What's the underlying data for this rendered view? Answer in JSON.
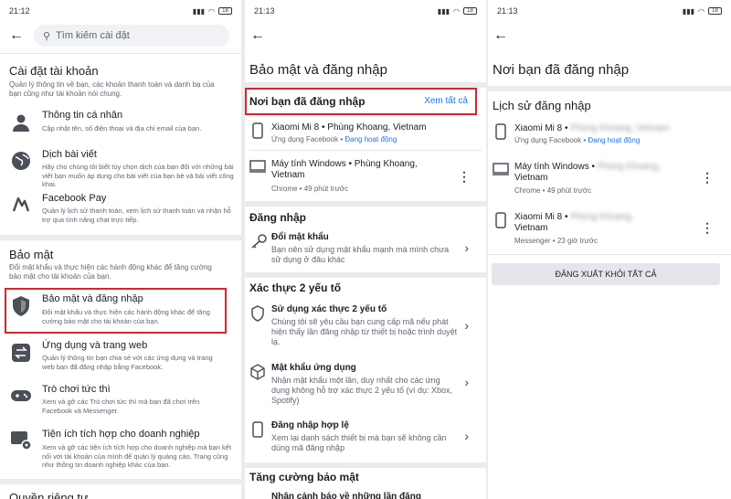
{
  "status": {
    "p1_time": "21:12",
    "p2_time": "21:13",
    "p3_time": "21:13",
    "battery": "18"
  },
  "p1": {
    "search_placeholder": "Tìm kiếm cài đặt",
    "account_title": "Cài đặt tài khoản",
    "account_desc": "Quản lý thông tin về bạn, các khoản thanh toán và danh bạ của bạn cũng như tài khoản nói chung.",
    "items1": [
      {
        "title": "Thông tin cá nhân",
        "desc": "Cập nhật tên, số điện thoại và địa chỉ email của bạn."
      },
      {
        "title": "Dịch bài viết",
        "desc": "Hãy cho chúng tôi biết tùy chọn dịch của bạn đối với những bài viết bạn muốn áp dụng cho bài viết của bạn bè và bài viết công khai."
      },
      {
        "title": "Facebook Pay",
        "desc": "Quản lý lịch sử thanh toán, xem lịch sử thanh toán và nhận hỗ trợ qua tính năng chat trực tiếp."
      }
    ],
    "security_title": "Bảo mật",
    "security_desc": "Đổi mật khẩu và thực hiện các hành động khác để tăng cường bảo mật cho tài khoản của bạn.",
    "items2": [
      {
        "title": "Bảo mật và đăng nhập",
        "desc": "Đổi mật khẩu và thực hiện các hành động khác để tăng cường bảo mật cho tài khoản của bạn."
      },
      {
        "title": "Ứng dụng và trang web",
        "desc": "Quản lý thông tin bạn chia sẻ với các ứng dụng và trang web bạn đã đăng nhập bằng Facebook."
      },
      {
        "title": "Trò chơi tức thì",
        "desc": "Xem và gỡ các Trò chơi tức thì mà bạn đã chơi trên Facebook và Messenger."
      },
      {
        "title": "Tiện ích tích hợp cho doanh nghiệp",
        "desc": "Xem và gỡ các tiện ích tích hợp cho doanh nghiệp mà bạn kết nối với tài khoản của mình để quản lý quảng cáo, Trang cũng như thông tin doanh nghiệp khác của bạn."
      }
    ],
    "partial": "Quyền riêng tư"
  },
  "p2": {
    "title": "Bảo mật và đăng nhập",
    "where_title": "Nơi bạn đã đăng nhập",
    "see_all": "Xem tất cả",
    "devices": [
      {
        "name": "Xiaomi Mi 8 • Phùng Khoang, Vietnam",
        "sub": "Ứng dụng Facebook • ",
        "active": "Đang hoạt động"
      },
      {
        "name": "Máy tính Windows • Phùng Khoang, Vietnam",
        "sub": "Chrome • 49 phút trước"
      }
    ],
    "login_title": "Đăng nhập",
    "change_pw": {
      "title": "Đổi mật khẩu",
      "desc": "Bạn nên sử dụng mật khẩu mạnh mà mình chưa sử dụng ở đâu khác"
    },
    "twofa_title": "Xác thực 2 yếu tố",
    "twofa": {
      "title": "Sử dụng xác thực 2 yếu tố",
      "desc": "Chúng tôi sẽ yêu cầu bạn cung cấp mã nếu phát hiện thấy lần đăng nhập từ thiết bị hoặc trình duyệt lạ."
    },
    "apppw": {
      "title": "Mật khẩu ứng dụng",
      "desc": "Nhận mật khẩu một lần, duy nhất cho các ứng dụng không hỗ trợ xác thực 2 yếu tố (ví dụ: Xbox, Spotify)"
    },
    "trusted": {
      "title": "Đăng nhập hợp lệ",
      "desc": "Xem lại danh sách thiết bị mà bạn sẽ không cần dùng mã đăng nhập"
    },
    "extra_title": "Tăng cường bảo mật",
    "partial": "Nhận cảnh báo về những lần đăng"
  },
  "p3": {
    "title": "Nơi bạn đã đăng nhập",
    "history_title": "Lịch sử đăng nhập",
    "devices": [
      {
        "name": "Xiaomi Mi 8 •",
        "loc": "Phùng Khoang, Vietnam",
        "sub": "Ứng dụng Facebook • ",
        "active": "Đang hoạt động"
      },
      {
        "name": "Máy tính Windows •",
        "loc": "Phùng Khoang,",
        "name2": "Vietnam",
        "sub": "Chrome • 49 phút trước"
      },
      {
        "name": "Xiaomi Mi 8 •",
        "loc": "Phùng Khoang,",
        "name2": "Vietnam",
        "sub": "Messenger • 23 giờ trước"
      }
    ],
    "logout": "ĐĂNG XUẤT KHỎI TẤT CẢ"
  }
}
